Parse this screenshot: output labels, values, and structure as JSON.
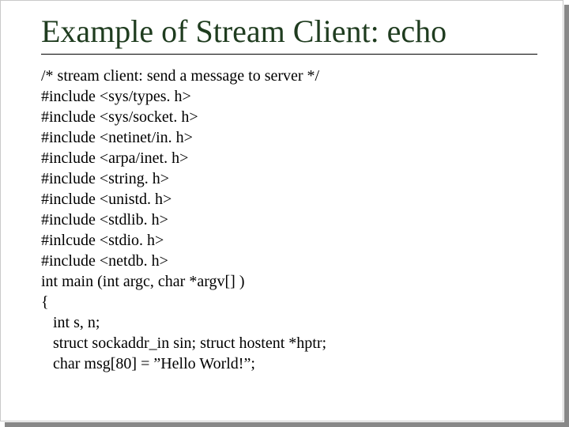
{
  "slide": {
    "title": "Example of Stream Client: echo",
    "code_lines": [
      "/* stream client: send a message to server */",
      "#include <sys/types. h>",
      "#include <sys/socket. h>",
      "#include <netinet/in. h>",
      "#include <arpa/inet. h>",
      "#include <string. h>",
      "#include <unistd. h>",
      "#include <stdlib. h>",
      "#inlcude <stdio. h>",
      "#include <netdb. h>",
      "int main (int argc, char *argv[] )",
      "{",
      "   int s, n;",
      "   struct sockaddr_in sin; struct hostent *hptr;",
      "   char msg[80] = ”Hello World!”;"
    ]
  }
}
